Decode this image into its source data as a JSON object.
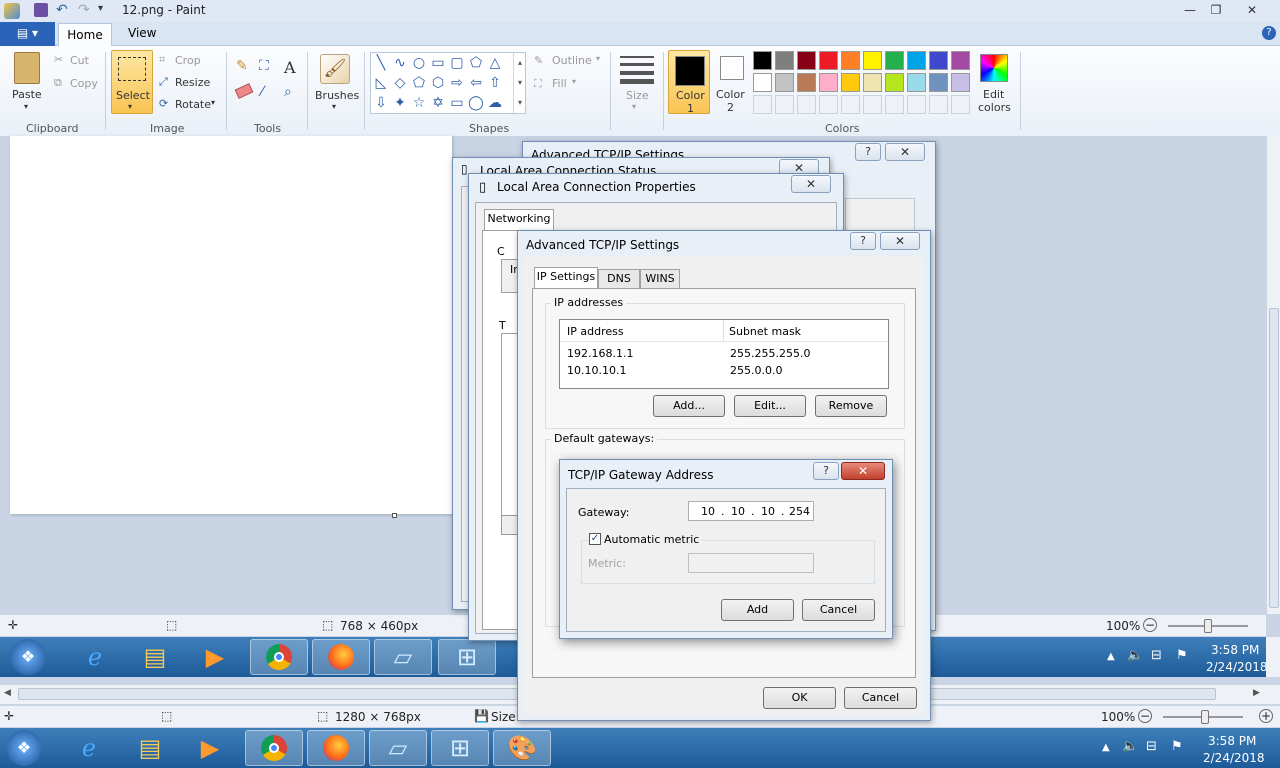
{
  "paint": {
    "title": "12.png - Paint",
    "tabs": {
      "home": "Home",
      "view": "View"
    },
    "clipboard": {
      "paste": "Paste",
      "cut": "Cut",
      "copy": "Copy",
      "group": "Clipboard"
    },
    "image": {
      "select": "Select",
      "crop": "Crop",
      "resize": "Resize",
      "rotate": "Rotate",
      "group": "Image"
    },
    "tools_group": "Tools",
    "brushes": "Brushes",
    "shapes": {
      "outline": "Outline",
      "fill": "Fill",
      "group": "Shapes"
    },
    "size": "Size",
    "color1": [
      "Color",
      "1"
    ],
    "color2": [
      "Color",
      "2"
    ],
    "colors_group": "Colors",
    "edit_colors": [
      "Edit",
      "colors"
    ],
    "palette_row1": [
      "#000000",
      "#7f7f7f",
      "#880015",
      "#ed1c24",
      "#ff7f27",
      "#fff200",
      "#22b14c",
      "#00a2e8",
      "#3f48cc",
      "#a349a4"
    ],
    "palette_row2": [
      "#ffffff",
      "#c3c3c3",
      "#b97a57",
      "#ffaec9",
      "#ffc90e",
      "#efe4b0",
      "#b5e61d",
      "#99d9ea",
      "#7092be",
      "#c8bfe7"
    ],
    "canvas_size": "768 × 460px",
    "zoom": "100%"
  },
  "inner_status": {
    "dims": "768 × 460px",
    "zoom": "100%",
    "time": "3:58 PM",
    "date": "2/24/2018"
  },
  "outer_status": {
    "dims": "1280 × 768px",
    "size_label": "Size:",
    "zoom": "100%"
  },
  "taskbar": {
    "time": "3:58 PM",
    "date": "2/24/2018"
  },
  "dialogs": {
    "adv_back_title": "Advanced TCP/IP Settings",
    "status_title": "Local Area Connection Status",
    "props_title": "Local Area Connection Properties",
    "props_tab": "Networking",
    "props_partial": {
      "c": "C",
      "in": "In",
      "t": "T"
    },
    "adv": {
      "title": "Advanced TCP/IP Settings",
      "tabs": [
        "IP Settings",
        "DNS",
        "WINS"
      ],
      "ip_group": "IP addresses",
      "col_ip": "IP address",
      "col_mask": "Subnet mask",
      "rows": [
        {
          "ip": "192.168.1.1",
          "mask": "255.255.255.0"
        },
        {
          "ip": "10.10.10.1",
          "mask": "255.0.0.0"
        }
      ],
      "add": "Add...",
      "edit": "Edit...",
      "remove": "Remove",
      "gw_group": "Default gateways:",
      "ok": "OK",
      "cancel": "Cancel"
    },
    "gw": {
      "title": "TCP/IP Gateway Address",
      "gateway_label": "Gateway:",
      "octets": [
        "10",
        "10",
        "10",
        "254"
      ],
      "auto_metric": "Automatic metric",
      "metric_label": "Metric:",
      "add": "Add",
      "cancel": "Cancel"
    }
  }
}
